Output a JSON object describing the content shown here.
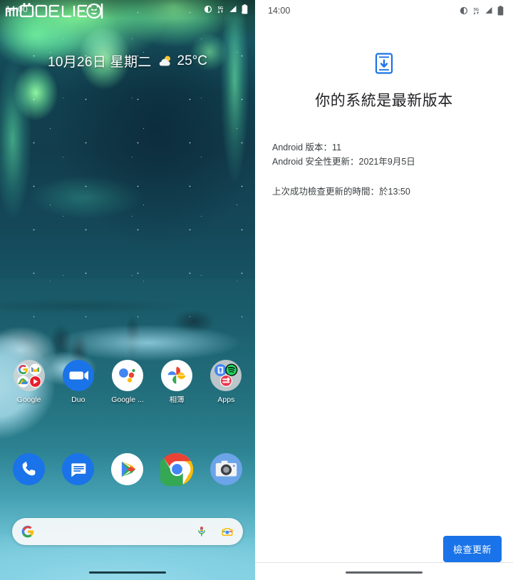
{
  "meta": {
    "layout": "side-by-side-phone-screenshots",
    "accent_blue": "#1a73e8",
    "panel_bg": "#ffffff"
  },
  "home_panel": {
    "watermark": {
      "text": "mobile01",
      "icon": "devil-face-logo-icon"
    },
    "status_bar": {
      "clock": "14:00",
      "icons": [
        {
          "name": "dnd-icon",
          "label": "do-not-disturb"
        },
        {
          "name": "network-5g-icon",
          "label": "5G"
        },
        {
          "name": "signal-strength-icon",
          "label": "signal"
        },
        {
          "name": "battery-icon",
          "label": "battery"
        }
      ]
    },
    "date_widget": {
      "date": "10月26日 星期二",
      "weather_icon": "partly-cloudy-icon",
      "temperature": "25°C"
    },
    "app_row": [
      {
        "label": "Google",
        "icon": "google-folder-icon"
      },
      {
        "label": "Duo",
        "icon": "duo-icon"
      },
      {
        "label": "Google ...",
        "icon": "google-assistant-icon"
      },
      {
        "label": "相簿",
        "icon": "google-photos-icon"
      },
      {
        "label": "Apps",
        "icon": "apps-folder-icon"
      }
    ],
    "dock_row": [
      {
        "label": "Phone",
        "icon": "phone-icon"
      },
      {
        "label": "Messages",
        "icon": "messages-icon"
      },
      {
        "label": "Play Store",
        "icon": "play-store-icon"
      },
      {
        "label": "Chrome",
        "icon": "chrome-icon"
      },
      {
        "label": "Camera",
        "icon": "camera-icon"
      }
    ],
    "search_bar": {
      "logo_icon": "google-g-icon",
      "placeholder": "",
      "value": "",
      "mic_icon": "microphone-icon",
      "lens_icon": "google-lens-icon"
    },
    "nav_pill": "gesture-nav-pill"
  },
  "update_panel": {
    "status_bar": {
      "clock": "14:00",
      "icons": [
        {
          "name": "dnd-icon",
          "label": "do-not-disturb"
        },
        {
          "name": "network-5g-icon",
          "label": "5G"
        },
        {
          "name": "signal-strength-icon",
          "label": "signal"
        },
        {
          "name": "battery-icon",
          "label": "battery"
        }
      ]
    },
    "hero": {
      "icon": "phone-download-update-icon",
      "title": "你的系統是最新版本"
    },
    "details": [
      "Android 版本：11",
      "Android 安全性更新：2021年9月5日"
    ],
    "last_check": "上次成功檢查更新的時間：於13:50",
    "primary_button": "檢查更新",
    "nav_pill": "gesture-nav-pill"
  }
}
